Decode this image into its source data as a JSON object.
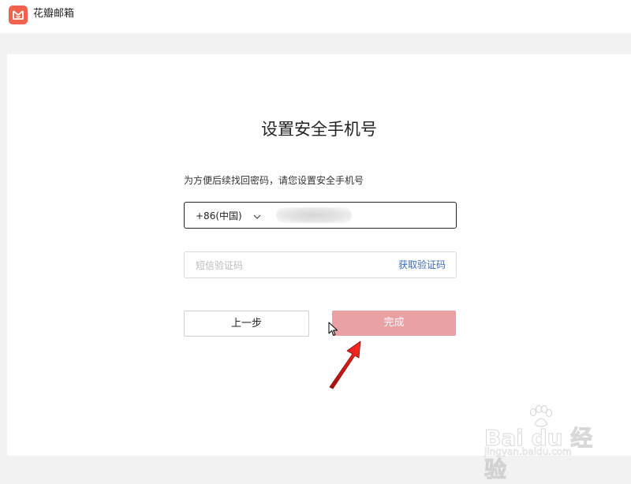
{
  "app": {
    "name": "花瓣邮箱",
    "brand_color": "#f0624d"
  },
  "page": {
    "title": "设置安全手机号",
    "hint": "为方便后续找回密码，请您设置安全手机号"
  },
  "phone": {
    "country_code": "+86(中国)",
    "number": ""
  },
  "sms": {
    "placeholder": "短信验证码",
    "value": "",
    "get_code_label": "获取验证码",
    "link_color": "#3b6bb5"
  },
  "buttons": {
    "prev_label": "上一步",
    "done_label": "完成",
    "done_color": "#e9a1a4"
  },
  "annotation_arrow_color": "#e0201c",
  "watermark": {
    "brand": "Bai du 经验",
    "url": "jingyan.baidu.com"
  }
}
